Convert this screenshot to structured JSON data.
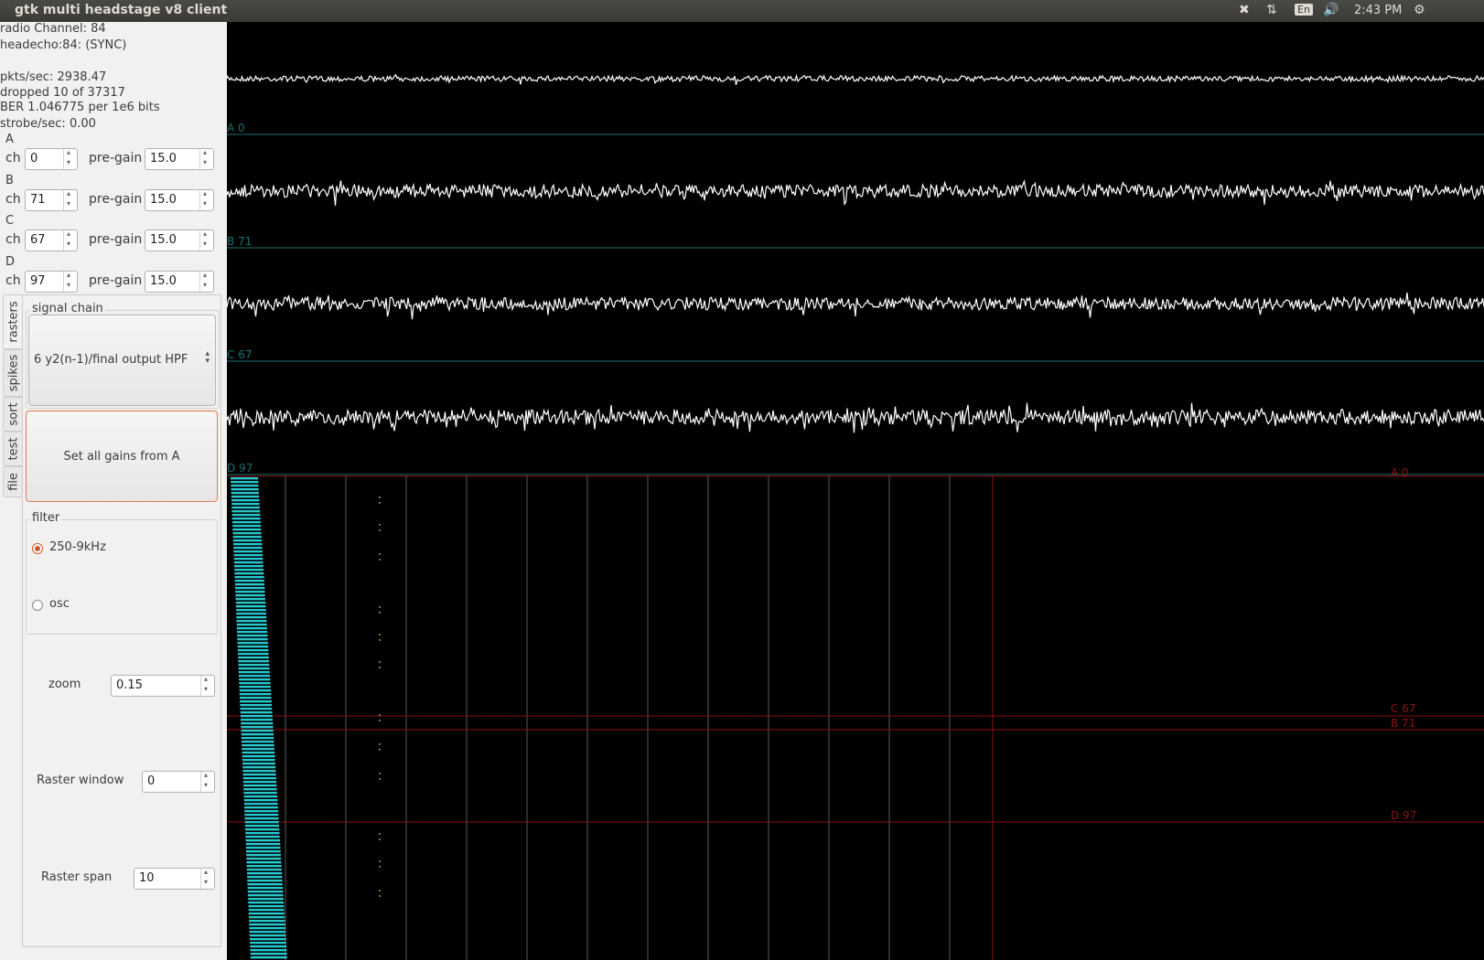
{
  "window": {
    "title": "gtk multi headstage v8 client"
  },
  "indicators": {
    "input_method": "En",
    "clock": "2:43 PM"
  },
  "status": {
    "radio_channel": "radio Channel: 84",
    "headecho": "headecho:84: (SYNC)",
    "pkts": "pkts/sec: 2938.47",
    "dropped": "dropped 10 of 37317",
    "ber": "BER 1.046775 per 1e6 bits",
    "strobe": "strobe/sec: 0.00"
  },
  "channels": [
    {
      "group": "A",
      "ch_label": "ch",
      "ch": "0",
      "gain_label": "pre-gain",
      "gain": "15.0"
    },
    {
      "group": "B",
      "ch_label": "ch",
      "ch": "71",
      "gain_label": "pre-gain",
      "gain": "15.0"
    },
    {
      "group": "C",
      "ch_label": "ch",
      "ch": "67",
      "gain_label": "pre-gain",
      "gain": "15.0"
    },
    {
      "group": "D",
      "ch_label": "ch",
      "ch": "97",
      "gain_label": "pre-gain",
      "gain": "15.0"
    }
  ],
  "tabs": [
    "rasters",
    "spikes",
    "sort",
    "test",
    "file"
  ],
  "active_tab": "rasters",
  "signal_chain": {
    "title": "signal chain",
    "selected": "6 y2(n-1)/final output HPF"
  },
  "set_gains_button": "Set all gains from A",
  "filter": {
    "title": "filter",
    "options": [
      "250-9kHz",
      "osc"
    ],
    "selected": "250-9kHz"
  },
  "zoom": {
    "label": "zoom",
    "value": "0.15"
  },
  "raster_window": {
    "label": "Raster window",
    "value": "0"
  },
  "raster_span": {
    "label": "Raster span",
    "value": "10"
  },
  "scope": {
    "trace_labels": [
      "A 0",
      "B 71",
      "C 67",
      "D 97"
    ],
    "raster_labels": [
      "A 0",
      "C 67",
      "B 71",
      "D 97"
    ],
    "colors": {
      "trace": "#ffffff",
      "divider": "#1b6f6f",
      "raster_line": "#8c1010",
      "grid": "#5a5a5a",
      "bars": "#27c9d0",
      "dots": "#8fa060"
    }
  }
}
